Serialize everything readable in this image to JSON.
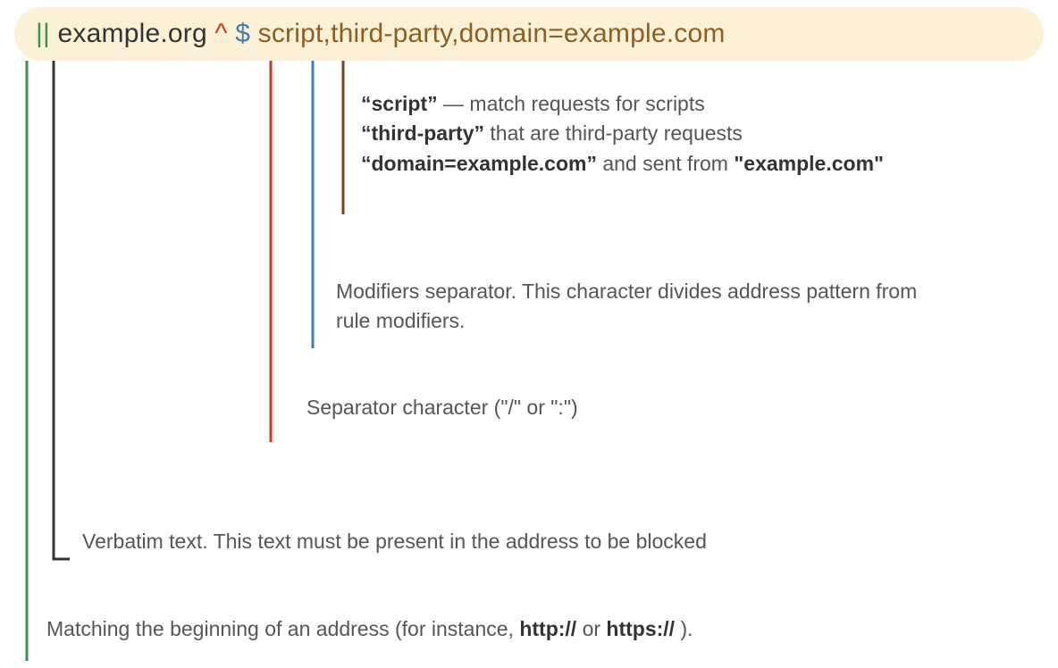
{
  "rule": {
    "pipes": "||",
    "space1": " ",
    "domain_text": "example.org",
    "space2": " ",
    "caret": "^",
    "space3": " ",
    "dollar": "$",
    "space4": " ",
    "modifiers": "script,third-party,domain=example.com"
  },
  "mods": {
    "script_q": "“script”",
    "script_dash": " — ",
    "script_tail": "match requests for scripts",
    "thirdparty_q": "“third-party”",
    "thirdparty_tail": "  that are third-party requests",
    "domain_q": "“domain=example.com”",
    "domain_tail": "  and sent from ",
    "domain_bold": "\"example.com\""
  },
  "dollar_desc": "Modifiers separator. This character divides address pattern from rule modifiers.",
  "caret_desc": "Separator character (\"/\" or \":\")",
  "verbatim_desc": "Verbatim text. This text must be present in the address to be blocked",
  "pipes_pre": "Matching the beginning of an address (for instance, ",
  "pipes_b1": "http://",
  "pipes_mid": "  or  ",
  "pipes_b2": "https://",
  "pipes_post": " )."
}
